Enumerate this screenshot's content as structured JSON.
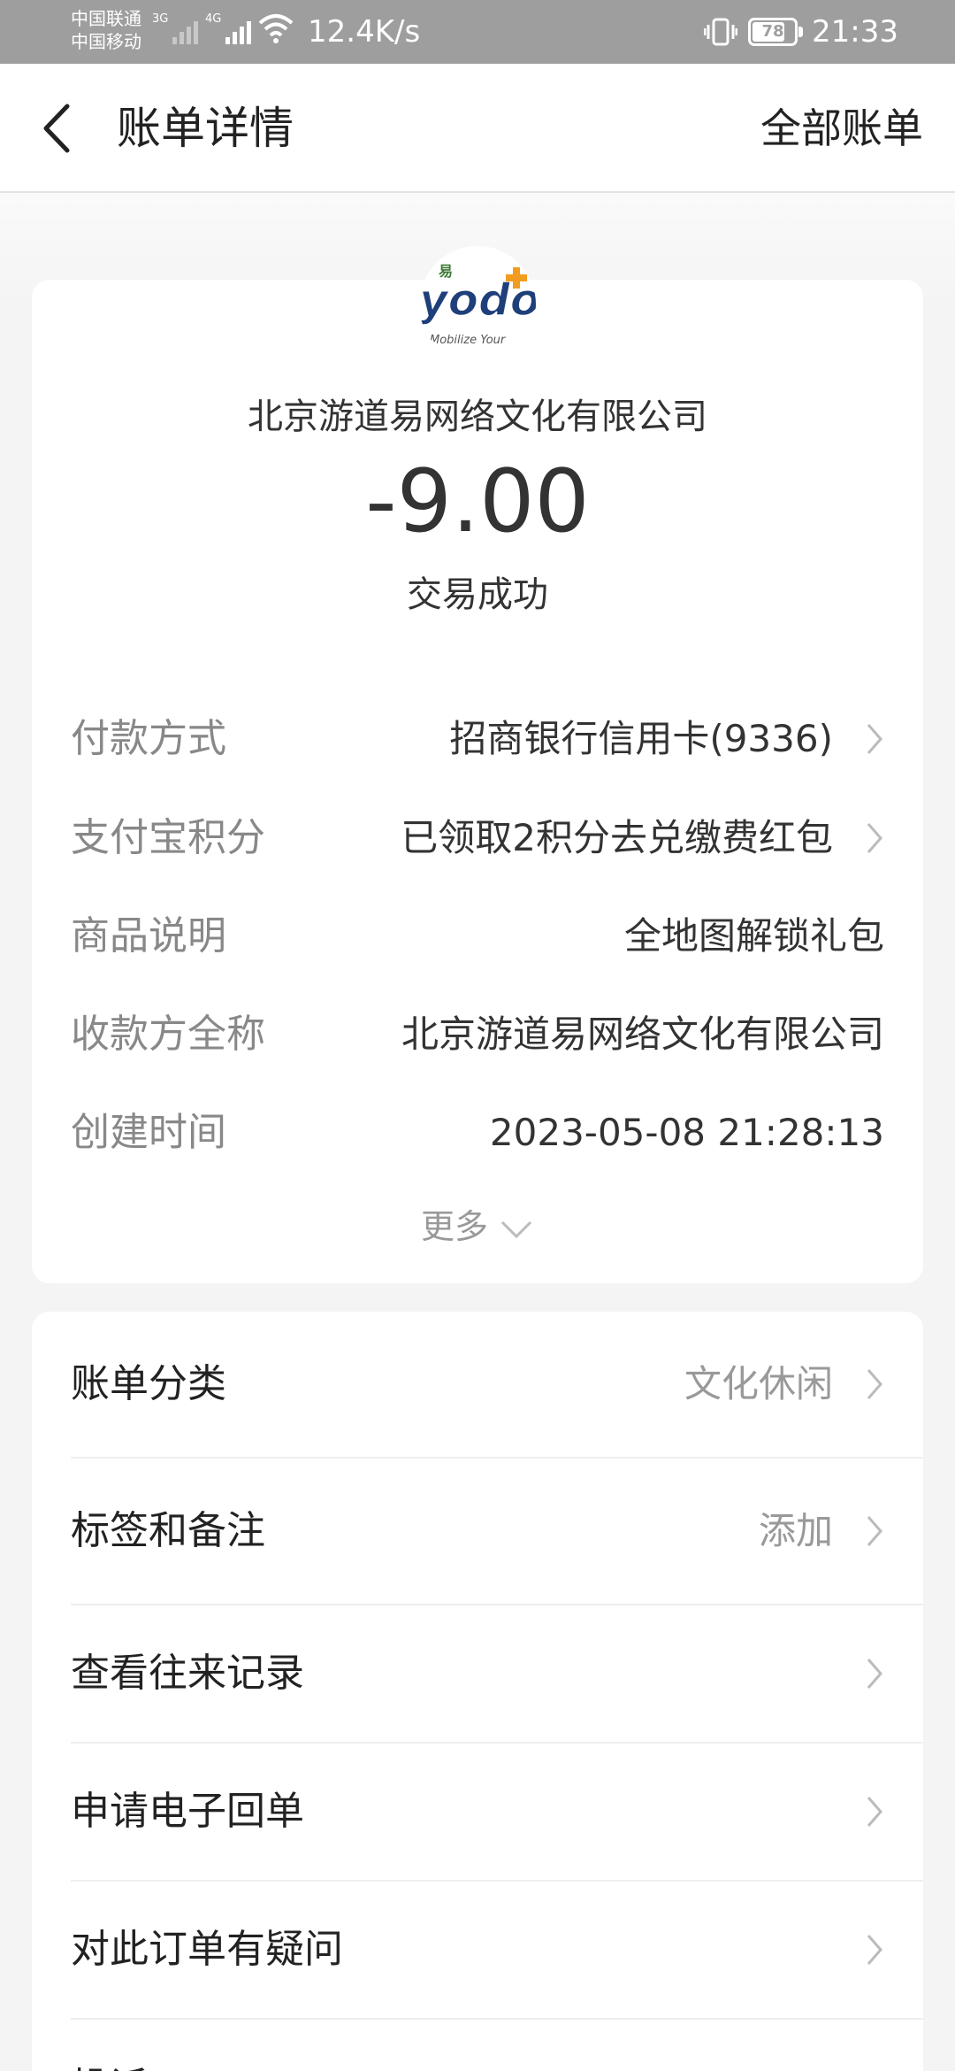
{
  "status_bar": {
    "carrier_1": "中国联通",
    "carrier_2": "中国移动",
    "net_1": "3G",
    "net_2": "4G",
    "speed": "12.4K/s",
    "battery": "78",
    "battery_level": 0.78,
    "time": "21:33"
  },
  "header": {
    "title": "账单详情",
    "all_bills": "全部账单"
  },
  "merchant_logo": {
    "text_top": "易",
    "text_main": "yodo",
    "text_sub": "Mobilize Your"
  },
  "summary": {
    "merchant": "北京游道易网络文化有限公司",
    "amount": "-9.00",
    "status": "交易成功"
  },
  "details": [
    {
      "label": "付款方式",
      "value": "招商银行信用卡(9336)"
    },
    {
      "label": "支付宝积分",
      "value": "已领取2积分去兑缴费红包"
    },
    {
      "label": "商品说明",
      "value": "全地图解锁礼包"
    },
    {
      "label": "收款方全称",
      "value": "北京游道易网络文化有限公司"
    },
    {
      "label": "创建时间",
      "value": "2023-05-08 21:28:13"
    }
  ],
  "more": "更多",
  "actions": [
    {
      "label": "账单分类",
      "value": "文化休闲"
    },
    {
      "label": "标签和备注",
      "value": "添加"
    },
    {
      "label": "查看往来记录",
      "value": ""
    },
    {
      "label": "申请电子回单",
      "value": ""
    },
    {
      "label": "对此订单有疑问",
      "value": ""
    },
    {
      "label": "投诉"
    }
  ],
  "colors": {
    "status_bar": "#9e9e9e",
    "page_bg": "#f4f4f4",
    "label_grey": "#888888",
    "text_dark": "#333333"
  }
}
